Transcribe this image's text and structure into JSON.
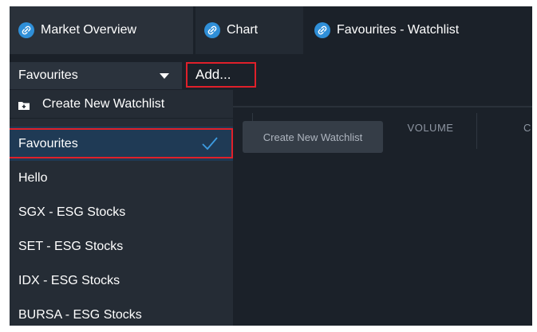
{
  "tabs": [
    {
      "label": "Market Overview",
      "icon": "link-icon"
    },
    {
      "label": "Chart",
      "icon": "link-icon"
    },
    {
      "label": "Favourites - Watchlist",
      "icon": "link-icon"
    }
  ],
  "toolbar": {
    "watchlist_select_value": "Favourites",
    "add_label": "Add..."
  },
  "dropdown": {
    "create_label": "Create New Watchlist",
    "items": [
      {
        "label": "Favourites",
        "selected": true
      },
      {
        "label": "Hello"
      },
      {
        "label": "SGX - ESG Stocks"
      },
      {
        "label": "SET - ESG Stocks"
      },
      {
        "label": "IDX - ESG Stocks"
      },
      {
        "label": "BURSA - ESG Stocks"
      }
    ]
  },
  "tooltip": "Create New Watchlist",
  "table": {
    "headers": [
      "VOLUME",
      "C"
    ]
  },
  "colors": {
    "background": "#1b2129",
    "accent": "#2f8fd8",
    "selected_row": "#1f3a55",
    "highlight_frame": "#e0202a"
  }
}
